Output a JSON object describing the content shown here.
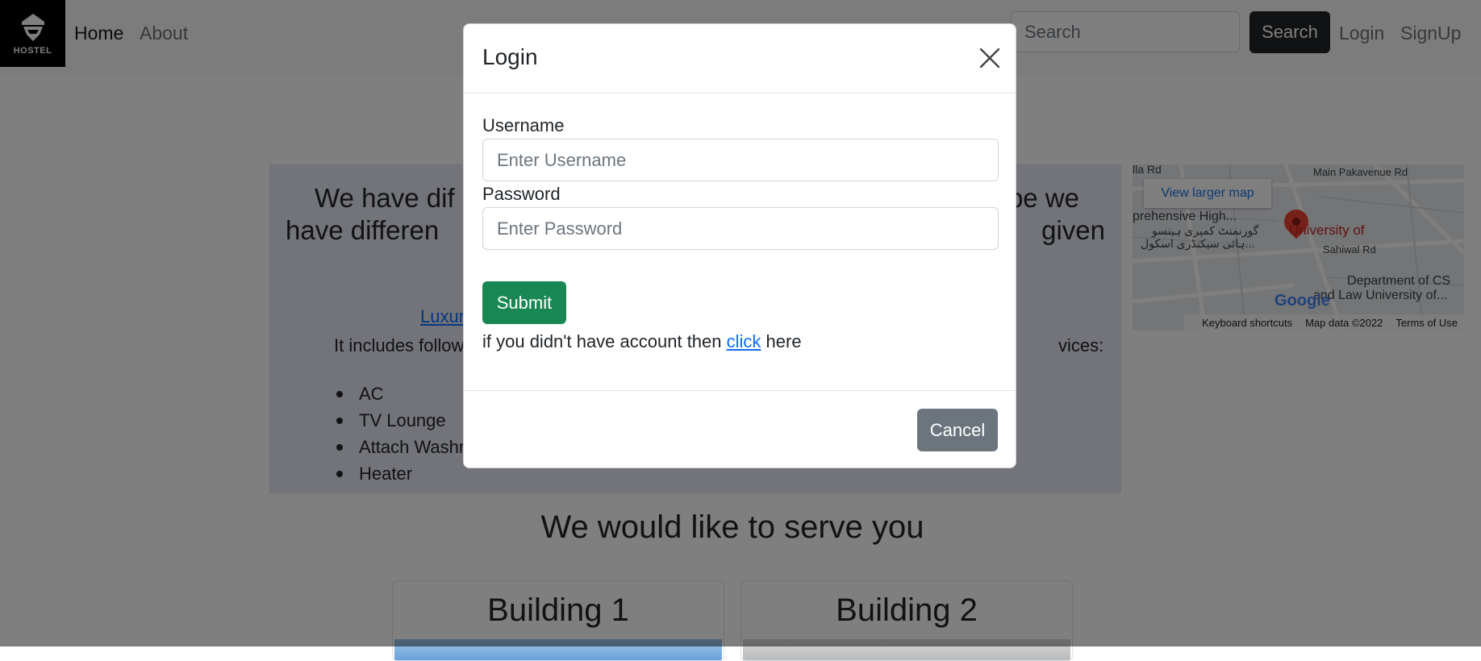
{
  "navbar": {
    "brand_text": "HOSTEL",
    "brand_icon": "hostel-logo-icon",
    "links": [
      {
        "label": "Home",
        "active": true
      },
      {
        "label": "About",
        "active": false
      }
    ],
    "search_placeholder": "Search",
    "search_button": "Search",
    "login": "Login",
    "signup": "SignUp"
  },
  "info": {
    "heading": "We have different types of rooms. For each room type we have different facilities given",
    "heading_line1_left": "We have dif",
    "heading_line1_right": "pe we",
    "heading_line2_left": "have differen",
    "heading_line2_right": "given",
    "link_partial": "Luxur",
    "text_left": "It includes follow",
    "text_right": "vices:",
    "features": [
      "AC",
      "TV Lounge",
      "Attach Washr",
      "Heater"
    ]
  },
  "map": {
    "view_larger": "View larger map",
    "labels": {
      "road1": "lla Rd",
      "road2": "Main Pakavenue Rd",
      "road3": "Sahiwal Rd",
      "school": "prehensive High...",
      "school_ur1": "گورنمنٹ کمپری ہینسو",
      "school_ur2": "ہائی سیکنڈری اسکول...",
      "university": "University of",
      "dept1": "Department of CS",
      "dept2": "and Law University of..."
    },
    "google": "Google",
    "footer": [
      "Keyboard shortcuts",
      "Map data ©2022",
      "Terms of Use"
    ]
  },
  "serve_heading": "We would like to serve you",
  "buildings": [
    "Building 1",
    "Building 2"
  ],
  "modal": {
    "title": "Login",
    "username_label": "Username",
    "username_placeholder": "Enter Username",
    "password_label": "Password",
    "password_placeholder": "Enter Password",
    "submit": "Submit",
    "signup_prefix": "if you didn't have account then ",
    "signup_link": "click",
    "signup_suffix": " here",
    "cancel": "Cancel"
  }
}
